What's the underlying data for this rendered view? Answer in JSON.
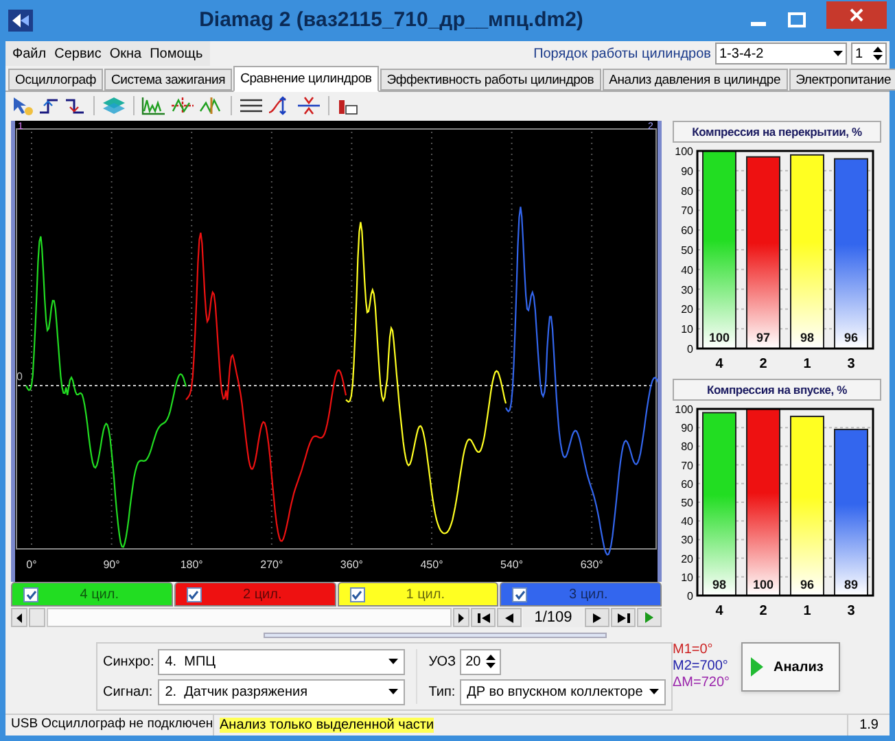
{
  "window": {
    "title": "Diamag 2 (ваз2115_710_др__мпц.dm2)"
  },
  "menu": [
    "Файл",
    "Сервис",
    "Окна",
    "Помощь"
  ],
  "cylinder_order": {
    "label": "Порядок работы цилиндров",
    "value": "1-3-4-2",
    "spin": "1"
  },
  "tabs": [
    {
      "label": "Осциллограф",
      "selected": false
    },
    {
      "label": "Система зажигания",
      "selected": false
    },
    {
      "label": "Сравнение цилиндров",
      "selected": true
    },
    {
      "label": "Эффективность работы цилиндров",
      "selected": false
    },
    {
      "label": "Анализ давления в цилиндре",
      "selected": false
    },
    {
      "label": "Электропитание",
      "selected": false
    }
  ],
  "plot": {
    "markers": [
      "1",
      "2"
    ],
    "zero_label": "0",
    "x_labels": [
      "0°",
      "90°",
      "180°",
      "270°",
      "360°",
      "450°",
      "540°",
      "630°"
    ]
  },
  "channels": [
    {
      "label": "4 цил.",
      "checked": true,
      "color": "#22dd22"
    },
    {
      "label": "2 цил.",
      "checked": true,
      "color": "#ee1111"
    },
    {
      "label": "1 цил.",
      "checked": true,
      "color": "#ffff22"
    },
    {
      "label": "3 цил.",
      "checked": true,
      "color": "#3366ee"
    }
  ],
  "navigation": {
    "position": "1/109"
  },
  "charts": [
    {
      "chart_data": {
        "type": "bar",
        "title": "Компрессия на перекрытии, %",
        "categories": [
          "4",
          "2",
          "1",
          "3"
        ],
        "values": [
          100,
          97,
          98,
          96
        ],
        "ylim": [
          0,
          100
        ],
        "yticks": [
          0,
          10,
          20,
          30,
          40,
          50,
          60,
          70,
          80,
          90,
          100
        ],
        "grid": true,
        "data_labels": true
      }
    },
    {
      "chart_data": {
        "type": "bar",
        "title": "Компрессия на впуске, %",
        "categories": [
          "4",
          "2",
          "1",
          "3"
        ],
        "values": [
          98,
          100,
          96,
          89
        ],
        "ylim": [
          0,
          100
        ],
        "yticks": [
          0,
          10,
          20,
          30,
          40,
          50,
          60,
          70,
          80,
          90,
          100
        ],
        "grid": true,
        "data_labels": true
      }
    }
  ],
  "controls": {
    "sync": {
      "label": "Синхро:",
      "value": "4.  МПЦ"
    },
    "signal": {
      "label": "Сигнал:",
      "value": "2.  Датчик разряжения"
    },
    "uoz": {
      "label": "УОЗ",
      "value": "20"
    },
    "type": {
      "label": "Тип:",
      "value": "ДР во впускном коллекторе"
    }
  },
  "markers": [
    {
      "text": "M1=0°",
      "color": "#cc2222"
    },
    {
      "text": "M2=700°",
      "color": "#2222aa"
    },
    {
      "text": "ΔM=720°",
      "color": "#9922aa"
    }
  ],
  "analyze_button": "Анализ",
  "status_bar": {
    "connection": "USB Осциллограф не подключен",
    "mode": "Анализ только выделенной части",
    "version": "1.9"
  }
}
